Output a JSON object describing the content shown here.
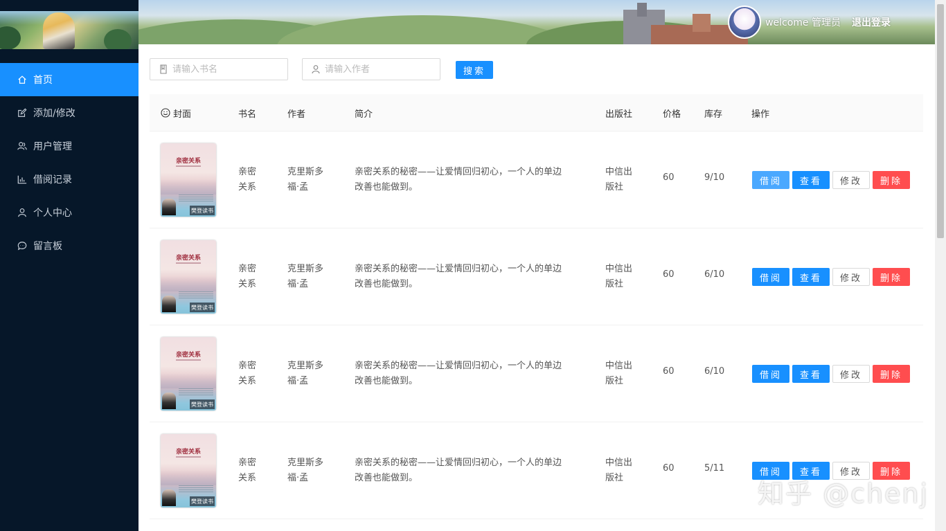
{
  "header": {
    "welcome": "welcome 管理员",
    "logout": "退出登录"
  },
  "sidebar": {
    "items": [
      {
        "label": "首页",
        "icon": "home-icon",
        "active": true
      },
      {
        "label": "添加/修改",
        "icon": "edit-icon"
      },
      {
        "label": "用户管理",
        "icon": "users-icon"
      },
      {
        "label": "借阅记录",
        "icon": "bar-chart-icon"
      },
      {
        "label": "个人中心",
        "icon": "user-icon"
      },
      {
        "label": "留言板",
        "icon": "message-icon"
      }
    ]
  },
  "search": {
    "book_placeholder": "请输入书名",
    "author_placeholder": "请输入作者",
    "button": "搜索"
  },
  "table": {
    "columns": [
      "封面",
      "书名",
      "作者",
      "简介",
      "出版社",
      "价格",
      "库存",
      "操作"
    ],
    "rows": [
      {
        "title_line1": "亲密",
        "title_line2": "关系",
        "author_line1": "克里斯多",
        "author_line2": "福·孟",
        "desc_line1": "亲密关系的秘密——让爱情回归初心，一个人的单边",
        "desc_line2": "改善也能做到。",
        "publisher_line1": "中信出",
        "publisher_line2": "版社",
        "price": "60",
        "stock": "9/10"
      },
      {
        "title_line1": "亲密",
        "title_line2": "关系",
        "author_line1": "克里斯多",
        "author_line2": "福·孟",
        "desc_line1": "亲密关系的秘密——让爱情回归初心，一个人的单边",
        "desc_line2": "改善也能做到。",
        "publisher_line1": "中信出",
        "publisher_line2": "版社",
        "price": "60",
        "stock": "6/10"
      },
      {
        "title_line1": "亲密",
        "title_line2": "关系",
        "author_line1": "克里斯多",
        "author_line2": "福·孟",
        "desc_line1": "亲密关系的秘密——让爱情回归初心，一个人的单边",
        "desc_line2": "改善也能做到。",
        "publisher_line1": "中信出",
        "publisher_line2": "版社",
        "price": "60",
        "stock": "6/10"
      },
      {
        "title_line1": "亲密",
        "title_line2": "关系",
        "author_line1": "克里斯多",
        "author_line2": "福·孟",
        "desc_line1": "亲密关系的秘密——让爱情回归初心，一个人的单边",
        "desc_line2": "改善也能做到。",
        "publisher_line1": "中信出",
        "publisher_line2": "版社",
        "price": "60",
        "stock": "5/11"
      }
    ],
    "actions": {
      "borrow": "借阅",
      "view": "查看",
      "edit": "修改",
      "delete": "删除"
    },
    "cover_title": "亲密关系",
    "cover_badge": "樊登读书"
  },
  "watermark": "知乎 @chenj",
  "colors": {
    "primary": "#1890ff",
    "danger": "#ff4d4f",
    "sidebar": "#061729"
  }
}
